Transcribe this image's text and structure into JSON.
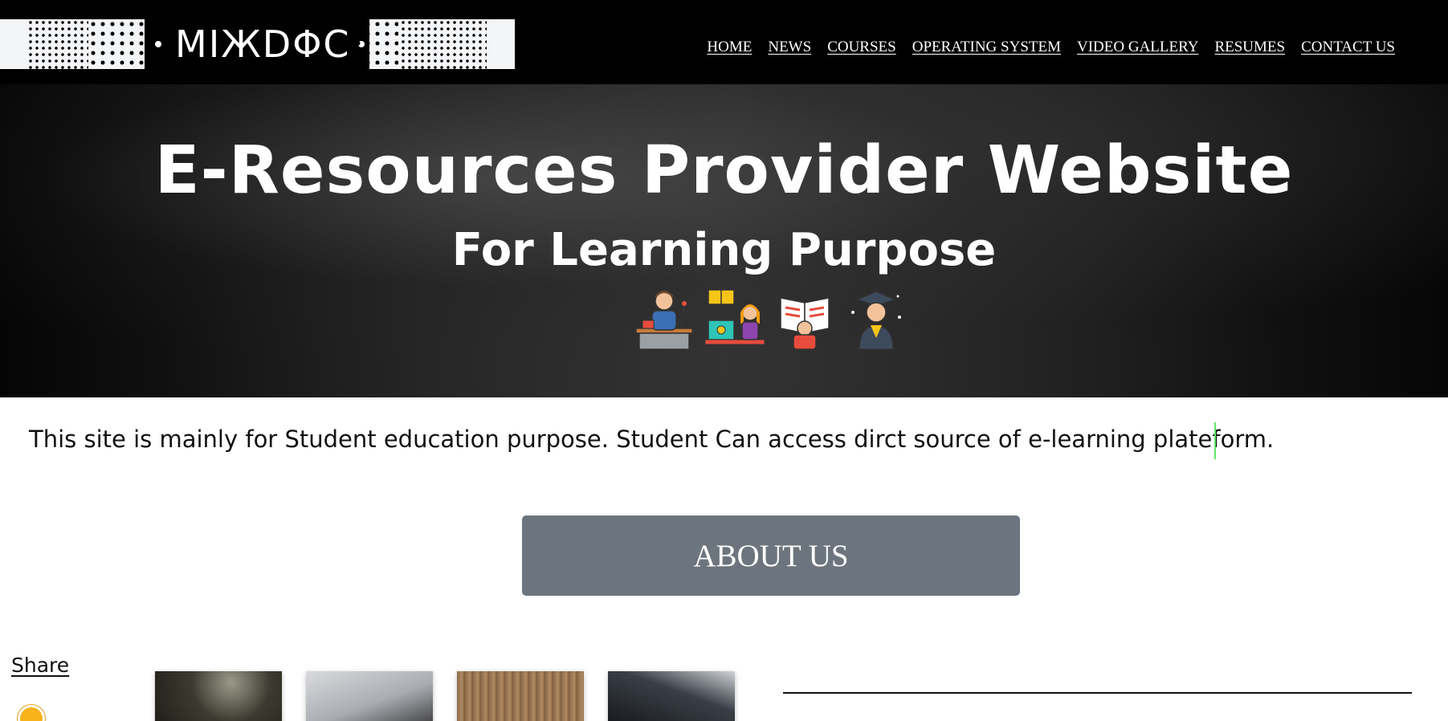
{
  "logo": {
    "text": "MIЖDΦC"
  },
  "nav": {
    "items": [
      "HOME",
      "NEWS",
      "COURSES",
      "OPERATING SYSTEM",
      "VIDEO GALLERY",
      "RESUMES",
      "CONTACT US"
    ]
  },
  "hero": {
    "title": "E-Resources Provider Website",
    "subtitle": "For Learning Purpose",
    "icons": [
      "teacher-at-desk-icon",
      "online-learning-icon",
      "student-reading-icon",
      "graduate-icon"
    ]
  },
  "intro": {
    "text": "This site is mainly for Student education purpose. Student Can access dirct source of e-learning plateform."
  },
  "about_button": {
    "label": "ABOUT US"
  },
  "share": {
    "label": "Share"
  },
  "colors": {
    "nav_bg": "#000000",
    "button_bg": "#6c757d",
    "caret": "#5ee86a",
    "phone_badge": "#f7b21c"
  }
}
